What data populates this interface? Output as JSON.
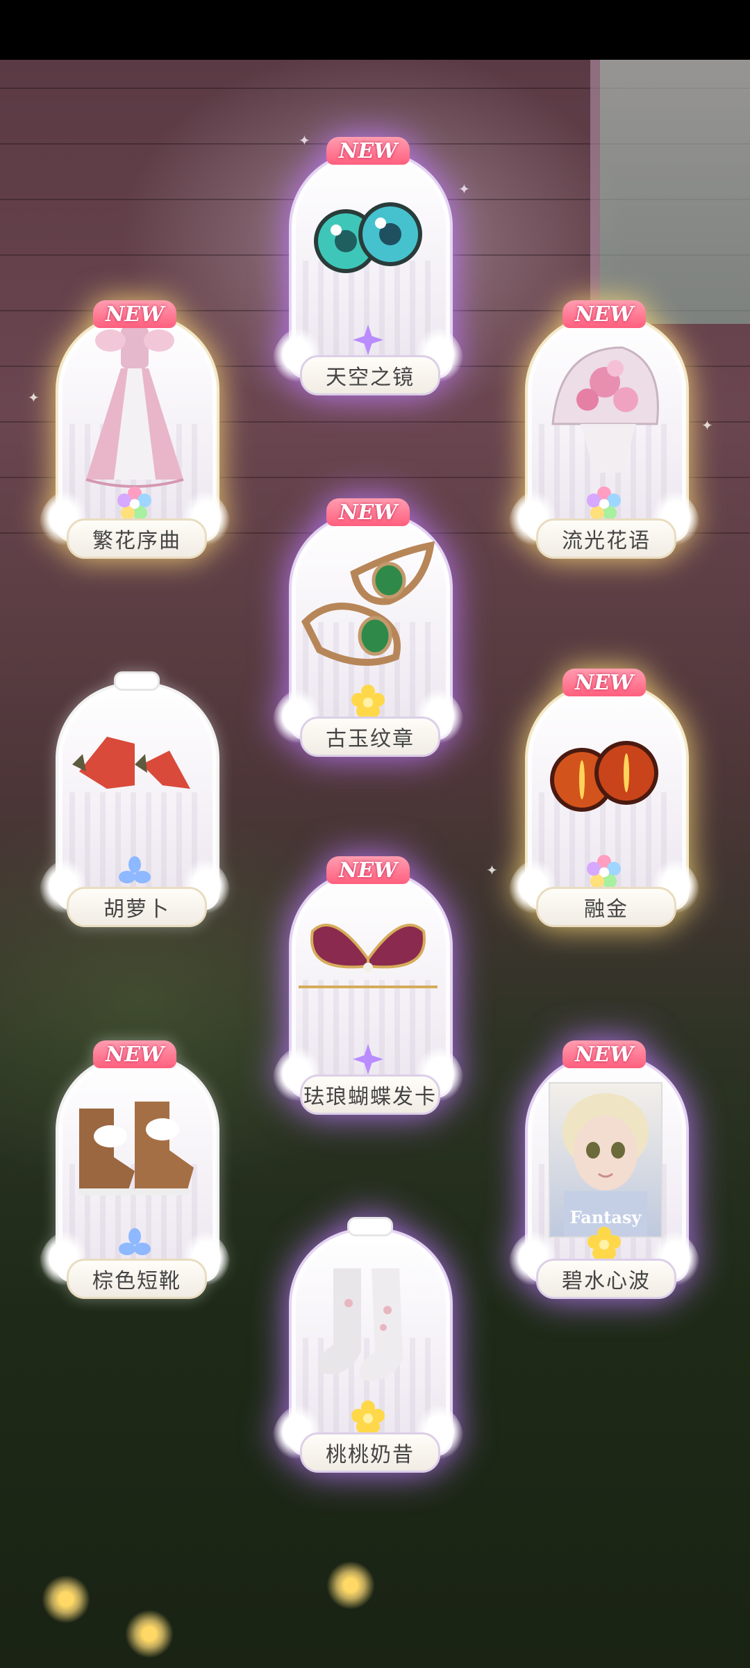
{
  "scene": {
    "description_colors": {
      "gold_glow": "#ffdc78",
      "purple_glow": "#be78ff",
      "new_ribbon": "#ff5f7e"
    }
  },
  "new_label": "NEW",
  "cards": [
    {
      "name": "繁花序曲",
      "new": true,
      "rarity": "rainbow",
      "glow": "gold",
      "item": "gown"
    },
    {
      "name": "天空之镜",
      "new": true,
      "rarity": "purple",
      "glow": "purple",
      "item": "teal-eyes"
    },
    {
      "name": "流光花语",
      "new": true,
      "rarity": "rainbow",
      "glow": "gold",
      "item": "rose-fan"
    },
    {
      "name": "古玉纹章",
      "new": true,
      "rarity": "gold",
      "glow": "purple",
      "item": "jade-ornament"
    },
    {
      "name": "胡萝卜",
      "new": false,
      "rarity": "blue",
      "glow": "none",
      "item": "carrots"
    },
    {
      "name": "融金",
      "new": true,
      "rarity": "rainbow",
      "glow": "gold",
      "item": "amber-eyes"
    },
    {
      "name": "珐琅蝴蝶发卡",
      "new": true,
      "rarity": "purple",
      "glow": "purple",
      "item": "butterfly-clip"
    },
    {
      "name": "棕色短靴",
      "new": true,
      "rarity": "blue",
      "glow": "none",
      "item": "brown-boots"
    },
    {
      "name": "碧水心波",
      "new": true,
      "rarity": "gold",
      "glow": "purple",
      "item": "portrait"
    },
    {
      "name": "桃桃奶昔",
      "new": false,
      "rarity": "gold",
      "glow": "purple",
      "item": "socks"
    }
  ],
  "portrait_caption": "Fantasy"
}
